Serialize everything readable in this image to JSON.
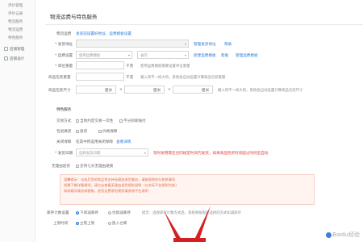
{
  "sidebar": {
    "items": [
      {
        "label": "评价管理",
        "sub": true
      },
      {
        "label": "评价记录",
        "sub": true
      },
      {
        "label": "物流服务",
        "sub": true
      },
      {
        "label": "物流运费",
        "sub": true
      },
      {
        "label": "特色服务",
        "sub": true
      },
      {
        "label": "店铺管理",
        "sub": false
      },
      {
        "label": "店铺设计",
        "sub": false
      }
    ]
  },
  "section": {
    "title": "物流运费与特色服务"
  },
  "form": {
    "freight_label": "物流运费",
    "freight_link": "发货前设置好地址，运费模板设置",
    "ship_addr_label": "发货地址",
    "ship_addr_link1": "管理发货地址",
    "ship_addr_link2": "帮助",
    "template_label": "运费设置",
    "template_value": "使用运费模板",
    "province_value": "省内",
    "template_link1": "新建运费模板",
    "template_link2": "帮助",
    "template_link3": "管理运费模板",
    "unit_weight_label": "单位重量",
    "unit_weight_unit": "千克",
    "unit_weight_note": "使用运费模板需要设置单位重量",
    "package_weight_label": "商品包装重量",
    "package_weight_unit": "千克",
    "package_weight_note": "输入项不一样大的，系统会自动设置计算商品包装重量",
    "package_size_label": "商品包装尺寸",
    "size_unit": "厘米",
    "size_note": "输入项不一样大的，系统会自动设置计算商品包装尺寸",
    "special_label": "特色服务",
    "delivery_label": "交易方式",
    "delivery_opt1": "当地约定交易一次性",
    "delivery_opt2": "不分别单独付",
    "guarantee_label": "包退换货",
    "guarantee_opt1": "退货",
    "guarantee_opt2": "价格保障",
    "after_sale_label": "关闭保障",
    "after_sale_text": "在其中所选用关闭保障",
    "after_sale_link": "查看详情",
    "invoice_label": "发货日期",
    "invoice_placeholder": "选择发货日期",
    "invoice_note": "现时采用需在合同规定时间内发货，如果商品购买时间超过时间后自动",
    "service_label": "无理由退货",
    "service_opt": "支持七天无理由退换",
    "notice_lines": [
      "温馨提示：勾选后您的商品将支持无理由退货服务，请按规则执行相关事项",
      "如需了解详细规则，请点击查看无理由退货规则说明（以实际平台规则为准）",
      "如有疑问请咨询客服，退货运费承担规则请参阅平台说明"
    ],
    "stock_label": "库存计数设置",
    "stock_opt1": "下单减库存",
    "stock_opt2": "付款减库存",
    "stock_note": "提示：选择库存计数方式后，系统将按照您选择的方式扣减库存",
    "onsale_label": "上架时间",
    "onsale_opt1": "立刻上架",
    "onsale_opt2": "放入仓库"
  },
  "watermark": {
    "text": "Baidu经验"
  },
  "colors": {
    "accent": "#2a7ae2",
    "warning": "#e4393c",
    "arrow": "#d42020"
  }
}
